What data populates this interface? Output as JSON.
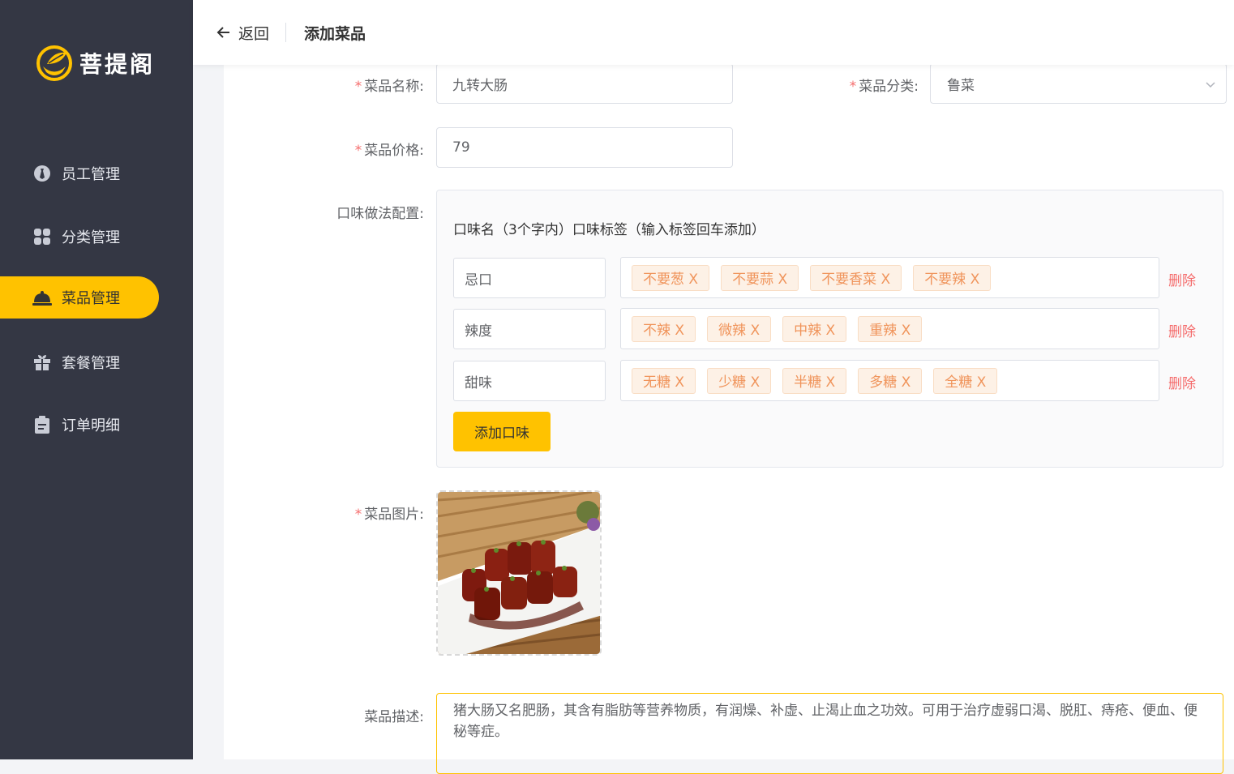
{
  "brand": {
    "name": "菩提阁",
    "accent": "#ffc200",
    "sidebar_bg": "#343744"
  },
  "sidebar": {
    "items": [
      {
        "label": "员工管理",
        "icon": "employee-icon",
        "active": false
      },
      {
        "label": "分类管理",
        "icon": "category-grid-icon",
        "active": false
      },
      {
        "label": "菜品管理",
        "icon": "dish-cloche-icon",
        "active": true
      },
      {
        "label": "套餐管理",
        "icon": "gift-icon",
        "active": false
      },
      {
        "label": "订单明细",
        "icon": "clipboard-icon",
        "active": false
      }
    ]
  },
  "header": {
    "back_label": "返回",
    "title": "添加菜品"
  },
  "form": {
    "name_label": "菜品名称:",
    "name_value": "九转大肠",
    "category_label": "菜品分类:",
    "category_value": "鲁菜",
    "price_label": "菜品价格:",
    "price_value": "79",
    "flavor_label": "口味做法配置:",
    "flavor_header": "口味名（3个字内）口味标签（输入标签回车添加）",
    "flavors": [
      {
        "name": "忌口",
        "tags": [
          "不要葱 X",
          "不要蒜 X",
          "不要香菜 X",
          "不要辣 X"
        ],
        "delete_label": "删除"
      },
      {
        "name": "辣度",
        "tags": [
          "不辣 X",
          "微辣 X",
          "中辣 X",
          "重辣 X"
        ],
        "delete_label": "删除"
      },
      {
        "name": "甜味",
        "tags": [
          "无糖 X",
          "少糖 X",
          "半糖 X",
          "多糖 X",
          "全糖 X"
        ],
        "delete_label": "删除"
      }
    ],
    "add_flavor_label": "添加口味",
    "image_label": "菜品图片:",
    "desc_label": "菜品描述:",
    "desc_value": "猪大肠又名肥肠，其含有脂肪等营养物质，有润燥、补虚、止渴止血之功效。可用于治疗虚弱口渴、脱肛、痔疮、便血、便秘等症。"
  }
}
